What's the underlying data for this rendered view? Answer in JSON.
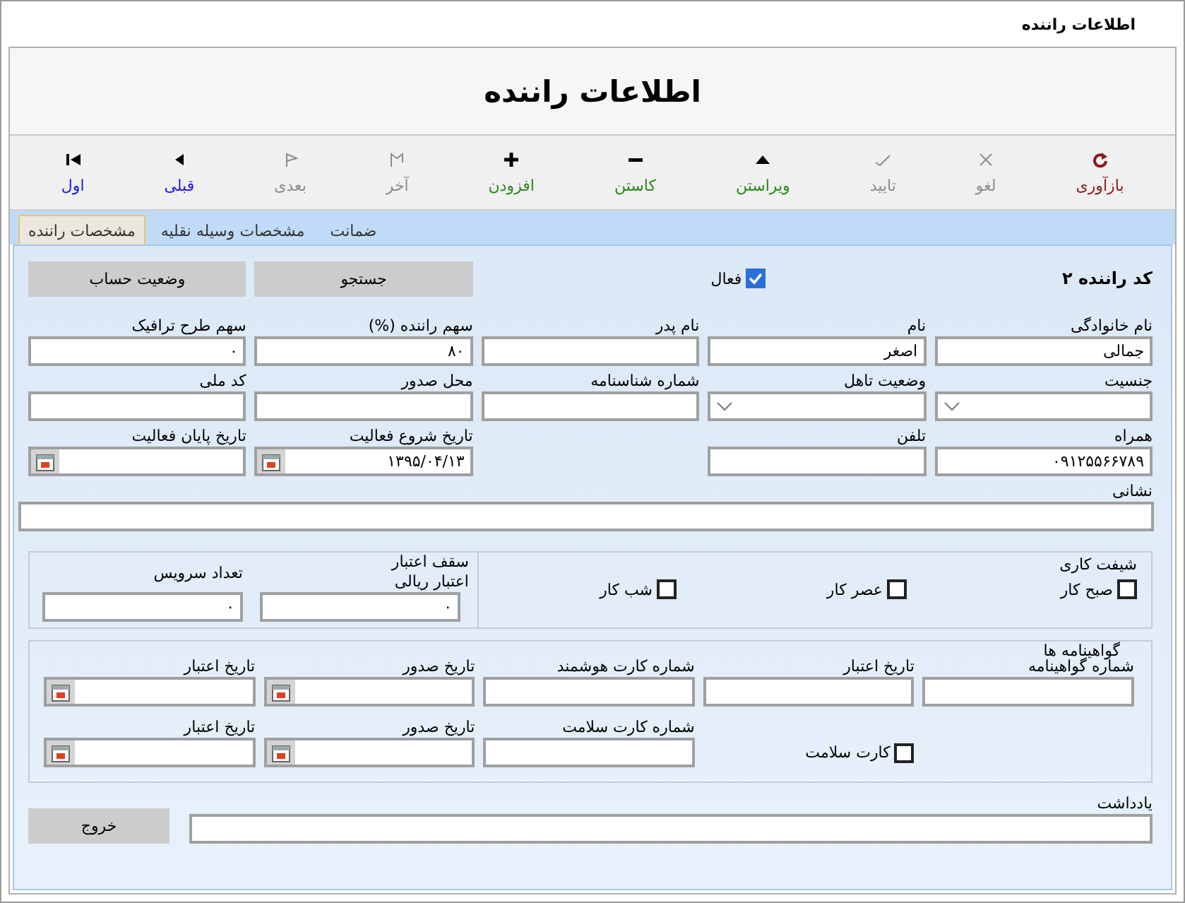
{
  "window": {
    "title": "اطلاعات راننده"
  },
  "header": {
    "title": "اطلاعات راننده"
  },
  "toolbar": [
    {
      "kind": "refresh",
      "label": "بازآوری",
      "disabled": false,
      "color": "#8b1a1a"
    },
    {
      "kind": "cancel",
      "label": "لغو",
      "disabled": true
    },
    {
      "kind": "confirm",
      "label": "تایید",
      "disabled": true
    },
    {
      "kind": "edit",
      "label": "ویراستن",
      "disabled": false,
      "color": "#2a8a1a"
    },
    {
      "kind": "remove",
      "label": "کاستن",
      "disabled": false,
      "color": "#2a8a1a"
    },
    {
      "kind": "add",
      "label": "افزودن",
      "disabled": false,
      "color": "#2a8a1a"
    },
    {
      "kind": "last",
      "label": "آخر",
      "disabled": true
    },
    {
      "kind": "next",
      "label": "بعدی",
      "disabled": true
    },
    {
      "kind": "previous",
      "label": "قبلی",
      "disabled": false,
      "color": "#1a1aee"
    },
    {
      "kind": "first",
      "label": "اول",
      "disabled": false,
      "color": "#1a1aee"
    }
  ],
  "tabs": [
    {
      "label": "ضمانت",
      "selected": false
    },
    {
      "label": "مشخصات وسیله نقلیه",
      "selected": false
    },
    {
      "label": "مشخصات راننده",
      "selected": true
    }
  ],
  "driver": {
    "code": "کد راننده ۲",
    "active": {
      "label": "فعال",
      "checked": true
    },
    "buttons": [
      "جستجو",
      "وضعیت حساب"
    ]
  },
  "rows": [
    [
      {
        "kind": "text",
        "label": "نام خانوادگی",
        "value": "جمالی"
      },
      {
        "kind": "text",
        "label": "نام",
        "value": "اصغر"
      },
      {
        "kind": "text",
        "label": "نام پدر"
      },
      {
        "kind": "text",
        "label": "سهم راننده (%)",
        "value": "۸۰"
      },
      {
        "kind": "text",
        "label": "سهم طرح ترافیک",
        "value": "۰"
      }
    ],
    [
      {
        "kind": "select",
        "label": "جنسیت"
      },
      {
        "kind": "select",
        "label": "وضعیت تاهل"
      },
      {
        "kind": "text",
        "label": "شماره شناسنامه"
      },
      {
        "kind": "text",
        "label": "محل صدور"
      },
      {
        "kind": "text",
        "label": "کد ملی"
      }
    ],
    [
      {
        "kind": "text",
        "label": "همراه",
        "value": "۰۹۱۲۵۵۶۶۷۸۹"
      },
      {
        "kind": "text",
        "label": "تلفن"
      },
      {
        "kind": "empty"
      },
      {
        "kind": "date",
        "label": "تاریخ شروع فعالیت",
        "value": "۱۳۹۵/۰۴/۱۳"
      },
      {
        "kind": "date",
        "label": "تاریخ پایان فعالیت"
      }
    ]
  ],
  "address": {
    "label": "نشانی"
  },
  "shift": {
    "title": "شیفت کاری",
    "options": [
      {
        "label": "صبح کار",
        "checked": false
      },
      {
        "label": "عصر کار",
        "checked": false
      },
      {
        "label": "شب کار",
        "checked": false
      }
    ],
    "credit": {
      "label_lines": [
        "سقف اعتبار",
        "اعتبار ریالی"
      ],
      "value": "۰"
    },
    "services": {
      "label": "تعداد سرویس",
      "value": "۰"
    }
  },
  "licenses": {
    "title": "گواهینامه ها",
    "rows": [
      [
        {
          "kind": "text",
          "label": "شماره گواهینامه"
        },
        {
          "kind": "text",
          "label": "تاریخ اعتبار"
        },
        {
          "kind": "text",
          "label": "شماره کارت هوشمند"
        },
        {
          "kind": "date",
          "label": "تاریخ صدور"
        },
        {
          "kind": "date",
          "label": "تاریخ اعتبار"
        }
      ],
      [
        {
          "kind": "empty"
        },
        {
          "kind": "checkbox",
          "label": "کارت سلامت",
          "checked": false
        },
        {
          "kind": "text",
          "label": "شماره کارت سلامت"
        },
        {
          "kind": "date",
          "label": "تاریخ صدور"
        },
        {
          "kind": "date",
          "label": "تاریخ اعتبار"
        }
      ]
    ]
  },
  "note": {
    "label": "یادداشت"
  },
  "exit_button": "خروج"
}
